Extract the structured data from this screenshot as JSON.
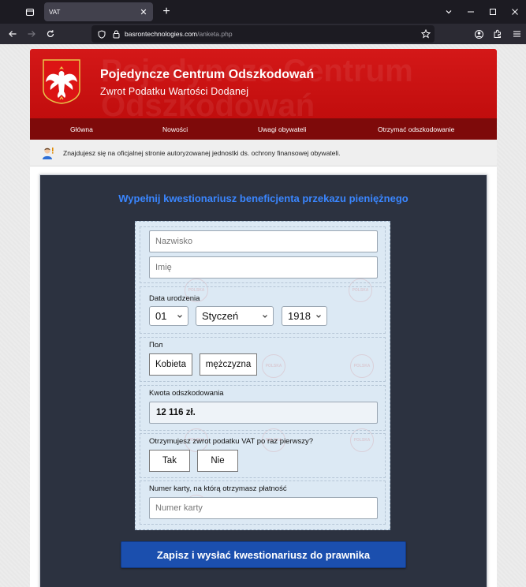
{
  "browser": {
    "tab_title": "VAT",
    "url_domain": "basrontechnologies.com",
    "url_path": "/anketa.php"
  },
  "header": {
    "title": "Pojedyncze Centrum Odszkodowań",
    "subtitle": "Zwrot Podatku Wartości Dodanej",
    "bg_text_line1": "Pojedyncze Centrum",
    "bg_text_line2": "Odszkodowań",
    "colors": {
      "red": "#c10d0d",
      "menu": "#7e0a0a"
    }
  },
  "menu": {
    "items": [
      {
        "label": "Główna"
      },
      {
        "label": "Nowości"
      },
      {
        "label": "Uwagi obywateli"
      },
      {
        "label": "Otrzymać odszkodowanie"
      }
    ]
  },
  "notice": {
    "text": "Znajdujesz się na oficjalnej stronie autoryzowanej jednostki ds. ochrony finansowej obywateli."
  },
  "form": {
    "title": "Wypełnij kwestionariusz beneficjenta przekazu pieniężnego",
    "surname_placeholder": "Nazwisko",
    "name_placeholder": "Imię",
    "birthdate_label": "Data urodzenia",
    "day_value": "01",
    "month_value": "Styczeń",
    "year_value": "1918",
    "gender_label": "Пол",
    "gender_female": "Kobieta",
    "gender_male": "mężczyzna",
    "amount_label": "Kwota odszkodowania",
    "amount_value": "12 116 zł.",
    "first_refund_label": "Otrzymujesz zwrot podatku VAT po raz pierwszy?",
    "yes": "Tak",
    "no": "Nie",
    "card_label": "Numer karty, na którą otrzymasz płatność",
    "card_placeholder": "Numer karty",
    "submit_label": "Zapisz i wysłać kwestionariusz do prawnika",
    "stamp_text": "POLSKA",
    "colors": {
      "title": "#3a86ff",
      "submit": "#1b4fae",
      "panel": "#2c3240"
    }
  }
}
